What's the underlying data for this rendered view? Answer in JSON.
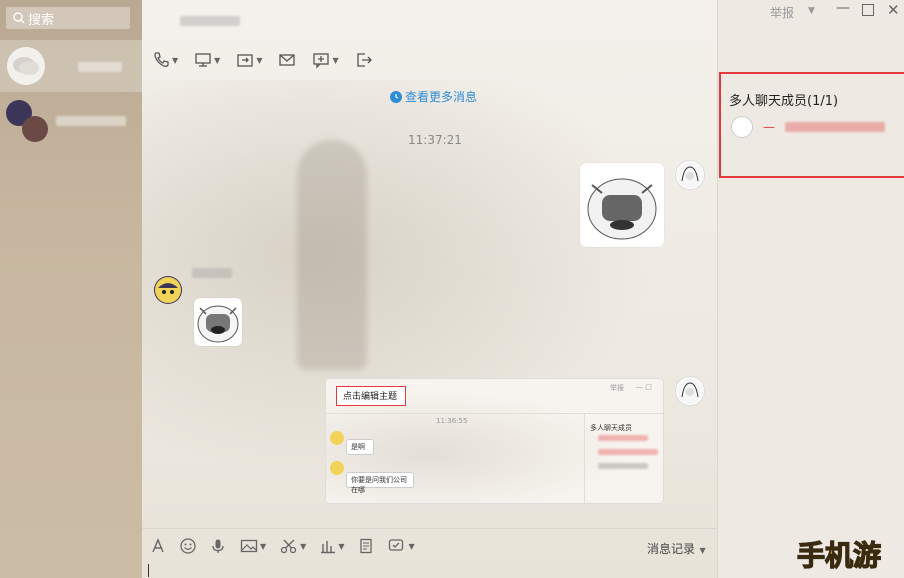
{
  "sidebar": {
    "search_placeholder": "搜索"
  },
  "toolbar": {
    "icons": [
      "phone-icon",
      "screen-share-icon",
      "file-transfer-icon",
      "mail-icon",
      "add-app-icon",
      "exit-icon"
    ]
  },
  "chat": {
    "more_messages": "查看更多消息",
    "timestamp": "11:37:21",
    "inner_screenshot": {
      "title": "点击编辑主题",
      "report": "举报",
      "time": "11:36:55",
      "msg1": "是啊",
      "msg2": "你要是问我们公司在哪",
      "members_title": "多人聊天成员"
    }
  },
  "input": {
    "history_label": "消息记录"
  },
  "window": {
    "report_label": "举报"
  },
  "members": {
    "title": "多人聊天成员(1/1)"
  },
  "watermark": {
    "text": "手机游"
  },
  "colors": {
    "accent_link": "#2d8cd6",
    "highlight_box": "#e4393c"
  }
}
